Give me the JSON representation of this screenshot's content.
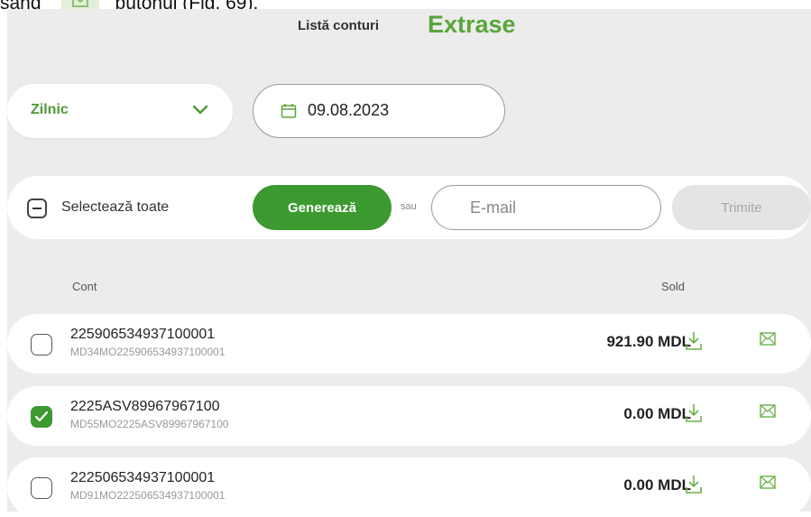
{
  "caption": {
    "prefix": "sând",
    "suffix": "butonul (Fig. 69)."
  },
  "header": {
    "nav_link": "Listă conturi",
    "title": "Extrase"
  },
  "filters": {
    "period": "Zilnic",
    "date": "09.08.2023"
  },
  "actions": {
    "select_all_label": "Selectează toate",
    "generate_label": "Generează",
    "or_label": "sau",
    "email_placeholder": "E-mail",
    "send_label": "Trimite"
  },
  "table": {
    "col_account": "Cont",
    "col_balance": "Sold",
    "rows": [
      {
        "account": "225906534937100001",
        "iban": "MD34MO225906534937100001",
        "balance": "921.90 MDL",
        "checked": false
      },
      {
        "account": "2225ASV89967967100",
        "iban": "MD55MO2225ASV89967967100",
        "balance": "0.00 MDL",
        "checked": true
      },
      {
        "account": "222506534937100001",
        "iban": "MD91MO222506534937100001",
        "balance": "0.00 MDL",
        "checked": false
      }
    ]
  },
  "colors": {
    "accent": "#3c9a30",
    "title_green": "#5aa53a",
    "background": "#ececec"
  },
  "icons": [
    "calendar-icon",
    "chevron-down-icon",
    "download-icon",
    "envelope-icon",
    "checkmark-icon"
  ]
}
